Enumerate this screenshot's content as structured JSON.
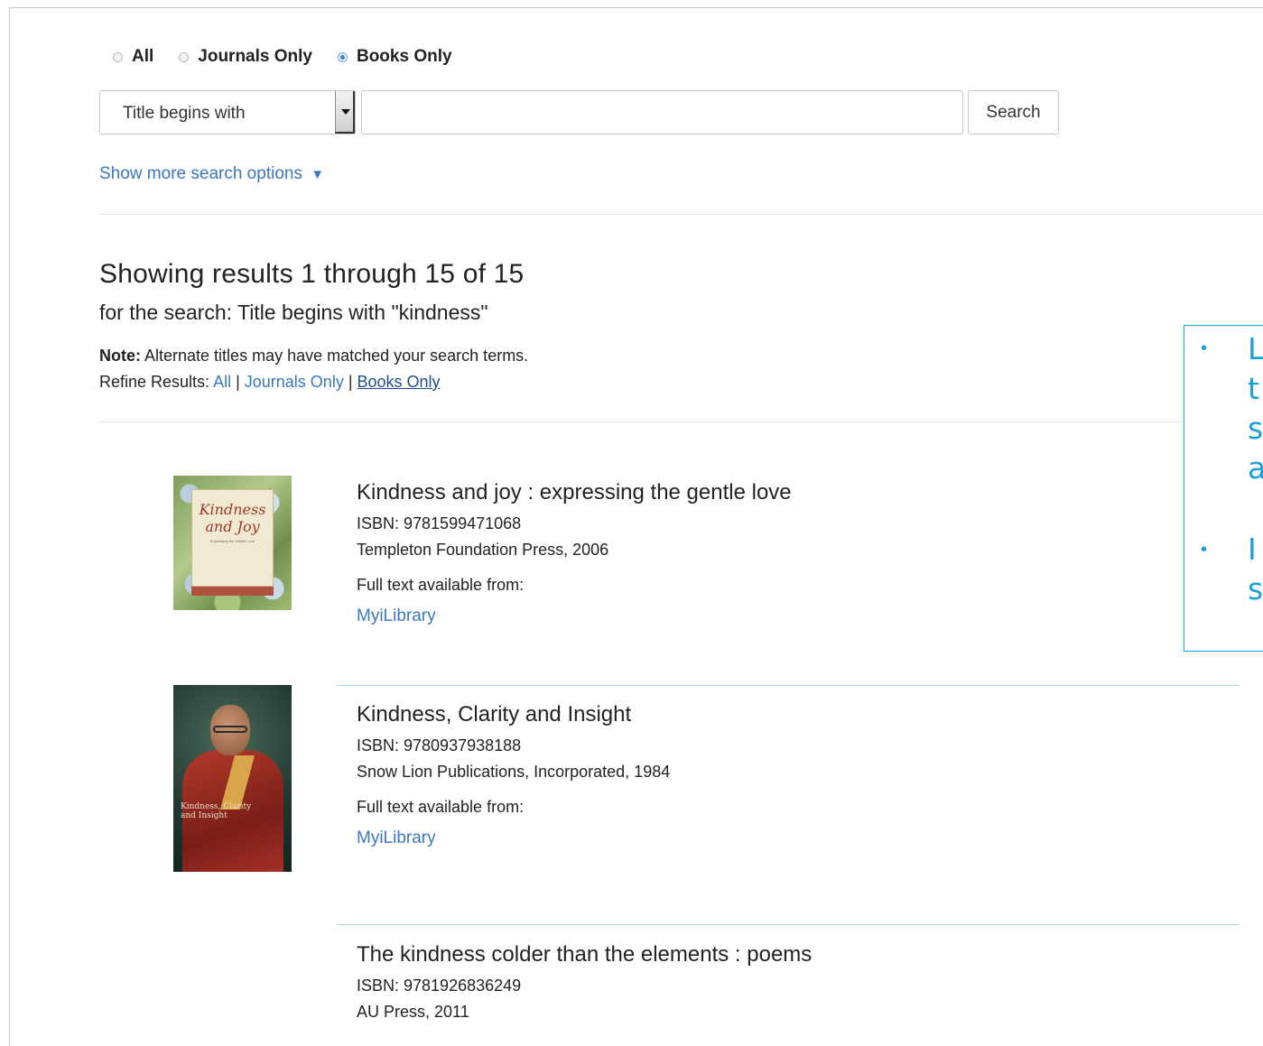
{
  "filters": {
    "options": [
      {
        "label": "All",
        "checked": false
      },
      {
        "label": "Journals Only",
        "checked": false
      },
      {
        "label": "Books Only",
        "checked": true
      }
    ]
  },
  "search": {
    "mode_selected": "Title begins with",
    "query_value": "",
    "button_label": "Search",
    "more_options_label": "Show more search options",
    "more_options_arrow": "▼"
  },
  "results": {
    "heading": "Showing results 1 through 15 of 15",
    "subheading": "for the search: Title begins with \"kindness\"",
    "note_label": "Note:",
    "note_text": " Alternate titles may have matched your search terms.",
    "refine_label": "Refine Results: ",
    "refine_all": "All",
    "refine_journals": "Journals Only",
    "refine_books": "Books Only",
    "refine_sep": " | "
  },
  "books": [
    {
      "title": "Kindness and joy : expressing the gentle love",
      "isbn": "ISBN: 9781599471068",
      "publisher": "Templeton Foundation Press, 2006",
      "availability": "Full text available from:",
      "provider": "MyiLibrary",
      "cover_line1": "Kindness",
      "cover_line2": "and Joy",
      "cover_line3": "Expressing the Gentle Love"
    },
    {
      "title": "Kindness, Clarity and Insight",
      "isbn": "ISBN: 9780937938188",
      "publisher": "Snow Lion Publications, Incorporated, 1984",
      "availability": "Full text available from:",
      "provider": "MyiLibrary",
      "cover_line1": "Kindness, Clarity",
      "cover_line2": "and Insight"
    },
    {
      "title": "The kindness colder than the elements : poems",
      "isbn": "ISBN: 9781926836249",
      "publisher": "AU Press, 2011"
    }
  ],
  "callout": {
    "bullet": "•",
    "lines": [
      "L",
      "t",
      "s",
      "a",
      "I",
      "s"
    ]
  },
  "colors": {
    "link": "#3a77c0",
    "accent": "#1aa0d8",
    "separator": "#a9d3ea"
  }
}
